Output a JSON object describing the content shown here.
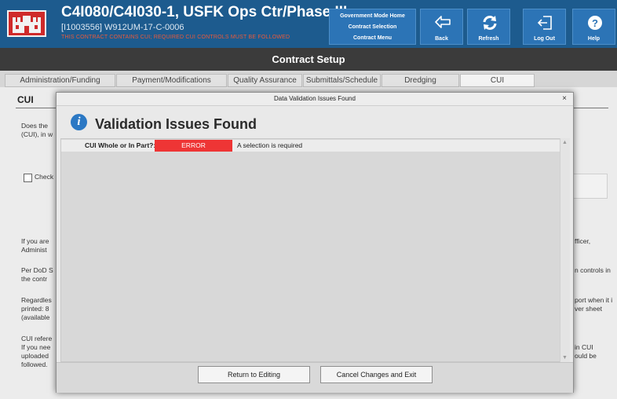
{
  "header": {
    "title": "C4I080/C4I030-1, USFK Ops Ctr/Phase III",
    "contract_id": "[I1003556] W912UM-17-C-0006",
    "cui_warning": "THIS CONTRACT CONTAINS CUI; REQUIRED CUI CONTROLS MUST BE FOLLOWED",
    "nav_links": [
      "Government Mode Home",
      "Contract Selection",
      "Contract Menu"
    ],
    "buttons": {
      "back": "Back",
      "refresh": "Refresh",
      "logout": "Log Out",
      "help": "Help"
    }
  },
  "section_title": "Contract Setup",
  "tabs": [
    {
      "label": "Administration/Funding"
    },
    {
      "label": "Payment/Modifications"
    },
    {
      "label": "Quality Assurance"
    },
    {
      "label": "Submittals/Schedule"
    },
    {
      "label": "Dredging"
    },
    {
      "label": "CUI",
      "active": true
    }
  ],
  "page": {
    "heading": "CUI",
    "left_fragments": [
      "Does the",
      "(CUI), in w",
      "Check",
      "If you are",
      "Administ",
      "Per DoD S",
      "the contr",
      "Regardles",
      "printed: 8",
      "(available",
      "CUI refere",
      "If you nee",
      "uploaded",
      "followed."
    ],
    "right_fragments": [
      "fficer,",
      "n controls in",
      "port when it i",
      "ver sheet",
      "in CUI",
      "ould be"
    ]
  },
  "modal": {
    "window_title": "Data Validation Issues Found",
    "close_symbol": "×",
    "heading": "Validation Issues Found",
    "issues": [
      {
        "field": "CUI Whole or In Part?:",
        "status": "ERROR",
        "message": "A selection is required"
      }
    ],
    "buttons": {
      "return": "Return to Editing",
      "cancel": "Cancel Changes and Exit"
    }
  },
  "colors": {
    "header_blue": "#1d5b8e",
    "button_blue": "#2c74b6",
    "title_bar": "#3b3b3b",
    "error_red": "#ee3535",
    "info_blue": "#2b78c4",
    "warning_text": "#e85a3c"
  },
  "icons": [
    "usace-castle-logo-icon",
    "back-arrow-icon",
    "refresh-icon",
    "logout-icon",
    "help-icon",
    "info-icon",
    "close-icon"
  ]
}
